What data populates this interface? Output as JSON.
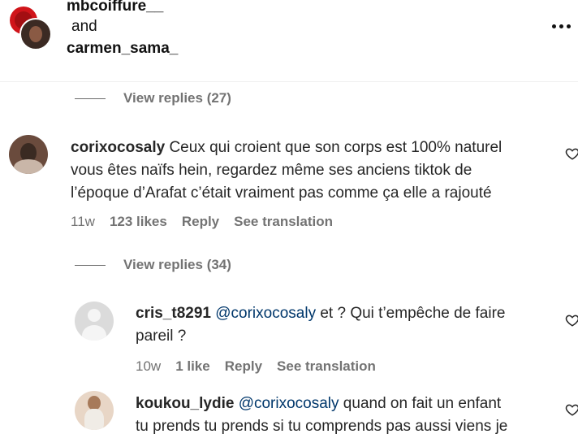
{
  "header": {
    "user1": "mbcoiffure__",
    "conjunction": "and",
    "user2": "carmen_sama_"
  },
  "comment1": {
    "view_replies": "View replies (27)"
  },
  "comment2": {
    "username": "corixocosaly",
    "text_line1": "Ceux qui croient que son corps est 100% naturel",
    "text_line2": "vous êtes naïfs hein, regardez même ses anciens tiktok de",
    "text_line3": "l’époque d’Arafat c’était vraiment pas comme ça elle a rajouté",
    "time": "11w",
    "likes": "123 likes",
    "reply": "Reply",
    "see_translation": "See translation",
    "view_replies": "View replies (34)"
  },
  "reply1": {
    "username": "cris_t8291",
    "mention": "@corixocosaly",
    "text_after_mention": " et ? Qui t’empêche de faire",
    "text_line2": "pareil ?",
    "time": "10w",
    "likes": "1 like",
    "reply": "Reply",
    "see_translation": "See translation"
  },
  "reply2": {
    "username": "koukou_lydie",
    "mention": "@corixocosaly",
    "text_after_mention": " quand on fait un enfant",
    "text_line2": "tu prends tu prends si tu comprends pas aussi viens je"
  },
  "colors": {
    "mention": "#00376b",
    "meta": "#737373",
    "text": "#262626"
  },
  "icons": [
    "more-icon",
    "heart-icon"
  ]
}
